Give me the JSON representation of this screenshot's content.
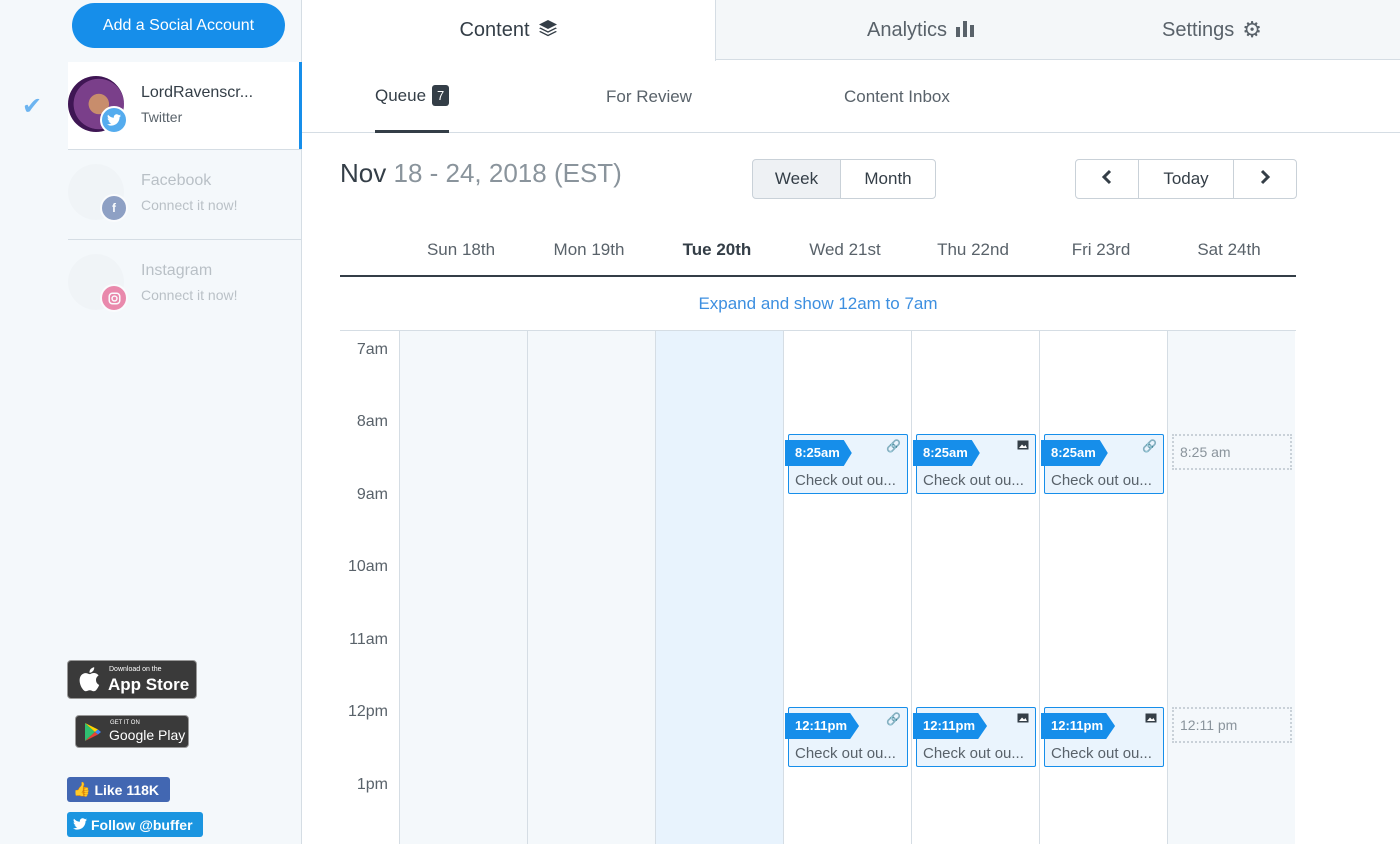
{
  "sidebar": {
    "add_account_label": "Add a Social Account",
    "accounts": [
      {
        "name": "LordRavenscr...",
        "network": "Twitter"
      },
      {
        "name": "Facebook",
        "network": "Connect it now!"
      },
      {
        "name": "Instagram",
        "network": "Connect it now!"
      }
    ],
    "appstore": {
      "small": "Download on the",
      "big": "App Store"
    },
    "googleplay": {
      "small": "GET IT ON",
      "big": "Google Play"
    },
    "like_label": "Like 118K",
    "follow_label": "Follow @buffer"
  },
  "top_tabs": [
    {
      "label": "Content",
      "icon": "layers-icon"
    },
    {
      "label": "Analytics",
      "icon": "bar-chart-icon"
    },
    {
      "label": "Settings",
      "icon": "gear-icon"
    }
  ],
  "sub_tabs": {
    "queue": "Queue",
    "queue_count": "7",
    "review": "For Review",
    "inbox": "Content Inbox"
  },
  "calendar": {
    "month": "Nov",
    "range": "18 - 24, 2018 (EST)",
    "view_week": "Week",
    "view_month": "Month",
    "today_label": "Today",
    "days": [
      "Sun 18th",
      "Mon 19th",
      "Tue 20th",
      "Wed 21st",
      "Thu 22nd",
      "Fri 23rd",
      "Sat 24th"
    ],
    "expand_label": "Expand and show 12am to 7am",
    "hours": [
      "7am",
      "8am",
      "9am",
      "10am",
      "11am",
      "12pm",
      "1pm"
    ],
    "post_text": "Check out ou...",
    "time_morning": "8:25am",
    "time_noon": "12:11pm",
    "slot_morning": "8:25 am",
    "slot_noon": "12:11 pm"
  },
  "colors": {
    "accent": "#168eea"
  }
}
